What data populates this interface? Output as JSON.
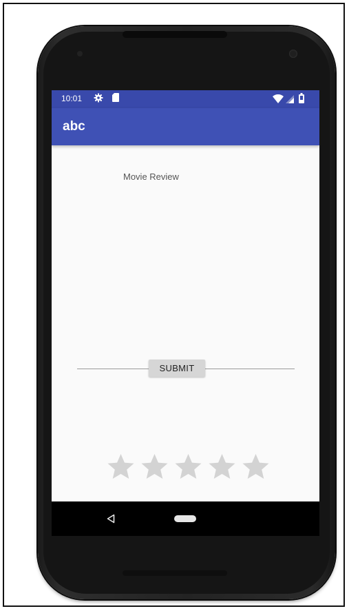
{
  "status_bar": {
    "time": "10:01",
    "icons": [
      "gear-icon",
      "sd-card-icon",
      "wifi-icon",
      "signal-icon",
      "battery-icon"
    ]
  },
  "app_bar": {
    "title": "abc"
  },
  "form": {
    "review_label": "Movie Review",
    "review_input_value": "",
    "submit_label": "SUBMIT",
    "rating": {
      "value": 0,
      "max": 5
    }
  },
  "nav_bar": {
    "icons": [
      "back-icon",
      "home-icon"
    ]
  },
  "colors": {
    "primary": "#3f51b5",
    "primary_dark": "#3949ab",
    "background": "#fafafa",
    "star_empty": "#d3d3d3"
  }
}
